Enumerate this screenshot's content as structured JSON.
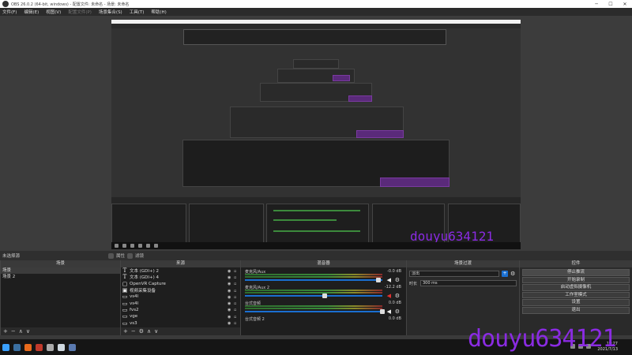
{
  "window": {
    "title": "OBS 26.0.2 (64-bit, windows) - 配置文件: 未命名 - 场景: 未命名",
    "minimize": "─",
    "maximize": "☐",
    "close": "✕"
  },
  "menu": [
    {
      "label": "文件(F)",
      "dim": false
    },
    {
      "label": "编辑(E)",
      "dim": false
    },
    {
      "label": "视图(V)",
      "dim": false
    },
    {
      "label": "配置文件(P)",
      "dim": true
    },
    {
      "label": "场景集合(S)",
      "dim": false
    },
    {
      "label": "工具(T)",
      "dim": false
    },
    {
      "label": "帮助(H)",
      "dim": false
    }
  ],
  "scene_bar": {
    "label": "未选择源",
    "properties": "属性",
    "filters": "滤镜"
  },
  "docks": {
    "scenes": {
      "title": "场景",
      "items": [
        {
          "label": "场景",
          "selected": true
        },
        {
          "label": "场景 2",
          "selected": false
        }
      ],
      "footer": [
        "+",
        "−",
        "∧",
        "∨"
      ]
    },
    "sources": {
      "title": "来源",
      "items": [
        {
          "icon": "T",
          "label": "文本 (GDI+) 2"
        },
        {
          "icon": "T",
          "label": "文本 (GDI+) 4"
        },
        {
          "icon": "▢",
          "label": "OpenVR Capture"
        },
        {
          "icon": "▣",
          "label": "视频采集设备"
        },
        {
          "icon": "▭",
          "label": "vs4l"
        },
        {
          "icon": "▭",
          "label": "vs4l"
        },
        {
          "icon": "▭",
          "label": "fvs2"
        },
        {
          "icon": "▭",
          "label": "vge"
        },
        {
          "icon": "▭",
          "label": "vs3"
        }
      ],
      "footer": [
        "+",
        "−",
        "⚙",
        "∧",
        "∨"
      ]
    },
    "mixer": {
      "title": "混音器",
      "tracks": [
        {
          "name": "麦克风/Aux",
          "db": "-0.0 dB",
          "level": 0.97
        },
        {
          "name": "麦克风/Aux 2",
          "db": "-12.2 dB",
          "level": 0.58
        },
        {
          "name": "台式音频",
          "db": "0.0 dB",
          "level": 1.0
        },
        {
          "name": "台式音频 2",
          "db": "0.0 dB",
          "level": 1.0
        }
      ]
    },
    "transitions": {
      "title": "场景过渡",
      "type": "淡出",
      "duration_label": "时长",
      "duration": "300 ms"
    },
    "controls": {
      "title": "控件",
      "buttons": [
        {
          "label": "停止推流",
          "active": true
        },
        {
          "label": "开始录制",
          "active": false
        },
        {
          "label": "启动虚拟摄像机",
          "active": false
        },
        {
          "label": "工作室模式",
          "active": false
        },
        {
          "label": "设置",
          "active": false
        },
        {
          "label": "退出",
          "active": false
        }
      ]
    }
  },
  "taskbar": {
    "apps": [
      {
        "name": "windows-icon",
        "color": "#3aa0ff"
      },
      {
        "name": "steam-icon",
        "color": "#3b6fa0"
      },
      {
        "name": "firefox-icon",
        "color": "#e86a1c"
      },
      {
        "name": "firefox-dev-icon",
        "color": "#c0392b"
      },
      {
        "name": "obs-icon",
        "color": "#aaaaaa"
      },
      {
        "name": "unreal-icon",
        "color": "#cfd8e0"
      },
      {
        "name": "app-u-icon",
        "color": "#5a7ab0"
      }
    ],
    "clock_time": "19:27",
    "clock_date": "2021/7/13"
  },
  "watermark": "douyu634121",
  "mini_watermark": "douyu634121",
  "colors": {
    "accent": "#1a6fd1",
    "watermark": "#8a2be2"
  }
}
